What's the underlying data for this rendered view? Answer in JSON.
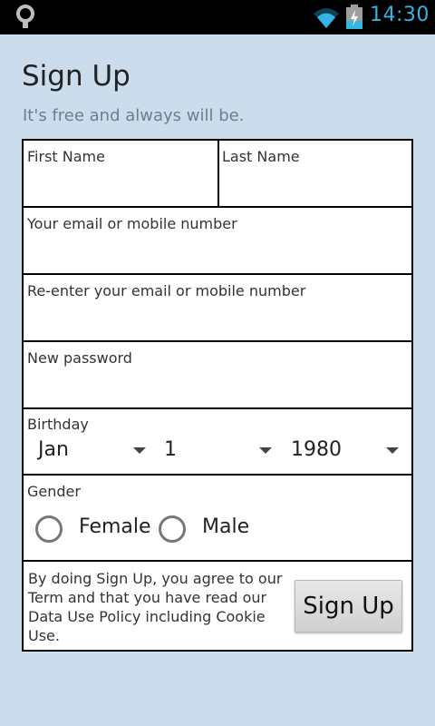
{
  "status_bar": {
    "time": "14:30",
    "icons": [
      "notification-icon",
      "wifi-icon",
      "battery-charging-icon"
    ],
    "time_color": "#33b5e5"
  },
  "header": {
    "title": "Sign Up",
    "subtitle": "It's free and always will be."
  },
  "form": {
    "first_name": {
      "label": "First Name",
      "value": ""
    },
    "last_name": {
      "label": "Last Name",
      "value": ""
    },
    "email": {
      "label": "Your email or mobile number",
      "value": ""
    },
    "email_confirm": {
      "label": "Re-enter your email or mobile number",
      "value": ""
    },
    "password": {
      "label": "New password",
      "value": ""
    },
    "birthday": {
      "label": "Birthday",
      "month": "Jan",
      "day": "1",
      "year": "1980"
    },
    "gender": {
      "label": "Gender",
      "options": [
        "Female",
        "Male"
      ],
      "selected": null
    },
    "terms": "By doing Sign Up, you agree to our Term and that you have read our Data Use Policy including Cookie Use.",
    "submit_label": "Sign Up"
  },
  "colors": {
    "background": "#cbdcec",
    "status_bar": "#000000",
    "accent": "#33b5e5"
  }
}
